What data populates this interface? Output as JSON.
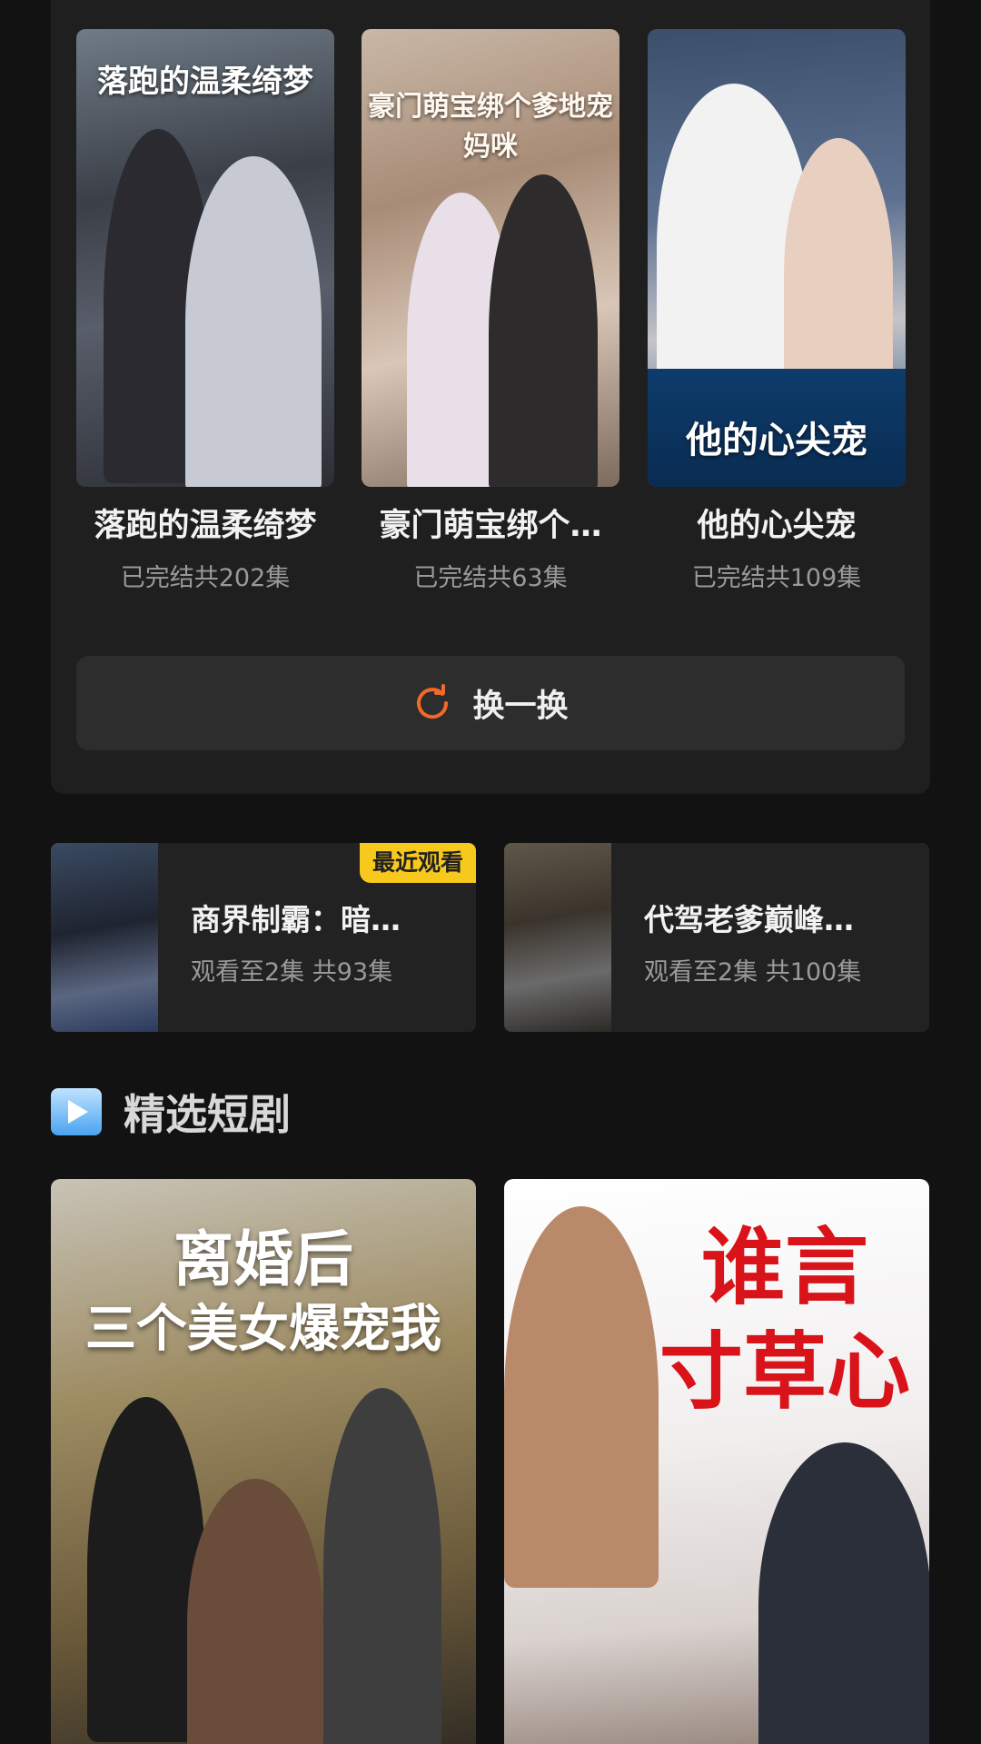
{
  "recommendations": [
    {
      "poster_title": "落跑的温柔绮梦",
      "title": "落跑的温柔绮梦",
      "status": "已完结共202集"
    },
    {
      "poster_title": "豪门萌宝绑个爹地宠妈咪",
      "title": "豪门萌宝绑个…",
      "status": "已完结共63集"
    },
    {
      "poster_title": "他的心尖宠",
      "title": "他的心尖宠",
      "status": "已完结共109集"
    }
  ],
  "refresh": {
    "label": "换一换",
    "icon": "refresh-icon",
    "icon_color": "#f26a2a"
  },
  "recent": [
    {
      "title": "商界制霸：暗…",
      "progress": "观看至2集 共93集",
      "badge": "最近观看"
    },
    {
      "title": "代驾老爹巅峰…",
      "progress": "观看至2集 共100集"
    }
  ],
  "section": {
    "title": "精选短剧",
    "icon": "play-icon"
  },
  "featured": [
    {
      "poster_title_line1": "离婚后",
      "poster_title_line2": "三个美女爆宠我"
    },
    {
      "poster_title_line1": "谁言",
      "poster_title_line2": "寸草心"
    }
  ],
  "colors": {
    "background": "#121212",
    "card": "#1f1f1f",
    "badge": "#f7c91c",
    "accent": "#f26a2a"
  }
}
